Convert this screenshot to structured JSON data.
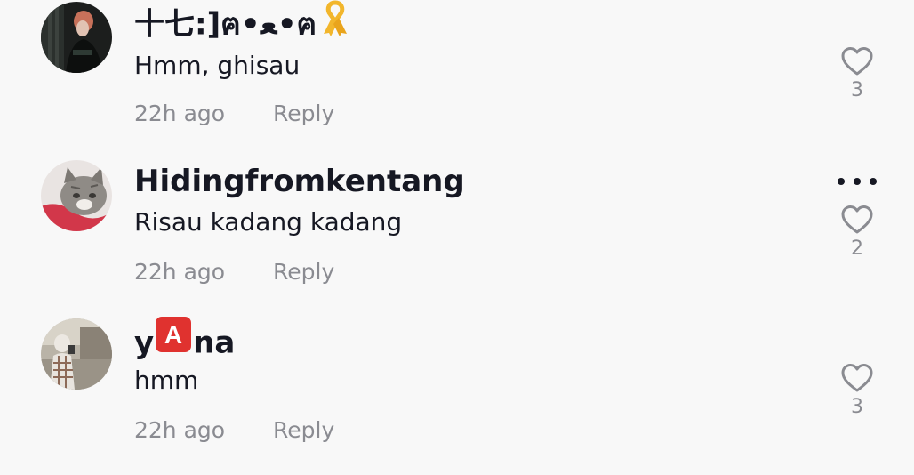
{
  "comments": [
    {
      "username": "十七:]ฅ•ﻌ•ฅ",
      "username_badge_icon": "yellow-ribbon-icon",
      "text": "Hmm, ghisau",
      "time": "22h ago",
      "reply_label": "Reply",
      "likes": "3",
      "has_more_menu": false
    },
    {
      "username": "Hidingfromkentang",
      "text": "Risau kadang kadang",
      "time": "22h ago",
      "reply_label": "Reply",
      "likes": "2",
      "has_more_menu": true,
      "more_icon": "more-options-icon"
    },
    {
      "username_prefix": "y",
      "username_badge": "A",
      "username_suffix": "na",
      "username_badge_color": "#e0322f",
      "text": "hmm",
      "time": "22h ago",
      "reply_label": "Reply",
      "likes": "3",
      "has_more_menu": false
    }
  ],
  "colors": {
    "background": "#f8f8f8",
    "primary_text": "#161823",
    "secondary_text": "#8a8b91"
  }
}
